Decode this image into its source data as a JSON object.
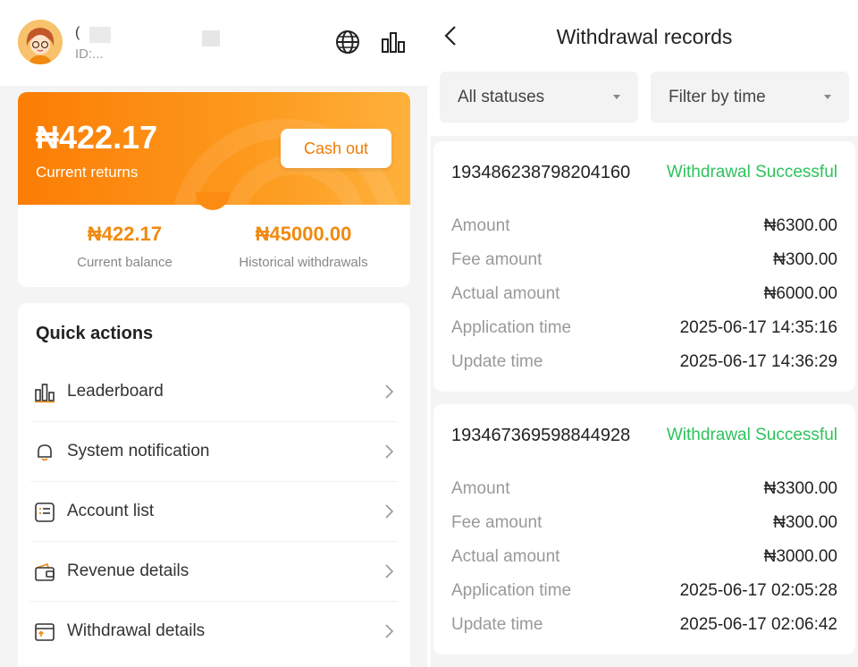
{
  "profile": {
    "name": "(",
    "id": "ID:..."
  },
  "returns": {
    "amount": "₦422.17",
    "label": "Current returns",
    "cashout_label": "Cash out",
    "current_balance_value": "₦422.17",
    "current_balance_label": "Current balance",
    "historical_value": "₦45000.00",
    "historical_label": "Historical withdrawals"
  },
  "quick_actions": {
    "title": "Quick actions",
    "items": [
      {
        "label": "Leaderboard",
        "icon": "leaderboard-icon"
      },
      {
        "label": "System notification",
        "icon": "bell-icon"
      },
      {
        "label": "Account list",
        "icon": "list-icon"
      },
      {
        "label": "Revenue details",
        "icon": "wallet-icon"
      },
      {
        "label": "Withdrawal details",
        "icon": "withdrawal-icon"
      }
    ]
  },
  "records_page": {
    "title": "Withdrawal records",
    "filters": {
      "status": "All statuses",
      "time": "Filter by time"
    },
    "records": [
      {
        "id": "193486238798204160",
        "status": "Withdrawal Successful",
        "rows": [
          {
            "label": "Amount",
            "value": "₦6300.00"
          },
          {
            "label": "Fee amount",
            "value": "₦300.00"
          },
          {
            "label": "Actual amount",
            "value": "₦6000.00"
          },
          {
            "label": "Application time",
            "value": "2025-06-17 14:35:16"
          },
          {
            "label": "Update time",
            "value": "2025-06-17 14:36:29"
          }
        ]
      },
      {
        "id": "193467369598844928",
        "status": "Withdrawal Successful",
        "rows": [
          {
            "label": "Amount",
            "value": "₦3300.00"
          },
          {
            "label": "Fee amount",
            "value": "₦300.00"
          },
          {
            "label": "Actual amount",
            "value": "₦3000.00"
          },
          {
            "label": "Application time",
            "value": "2025-06-17 02:05:28"
          },
          {
            "label": "Update time",
            "value": "2025-06-17 02:06:42"
          }
        ]
      }
    ]
  },
  "colors": {
    "accent_orange": "#fb7d05",
    "success_green": "#2ec25c"
  }
}
